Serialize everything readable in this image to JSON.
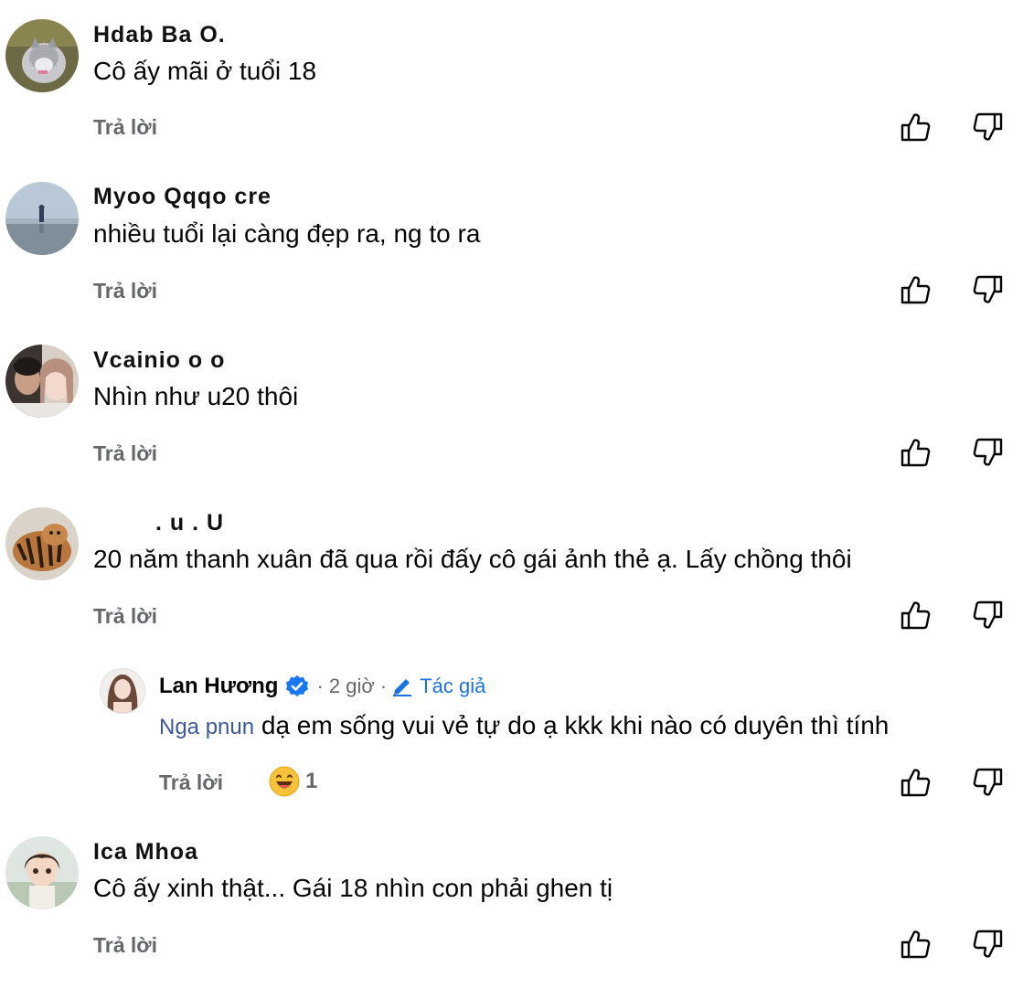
{
  "comments": [
    {
      "name": "Hdab Ba O.",
      "text": "Cô ấy mãi ở tuổi 18",
      "reply_label": "Trả lời"
    },
    {
      "name": "Myoo Qqqo cre",
      "text": "nhiều tuổi lại càng đẹp ra, ng to ra",
      "reply_label": "Trả lời"
    },
    {
      "name": "Vcainio o o",
      "text": "Nhìn như u20 thôi",
      "reply_label": "Trả lời"
    },
    {
      "name": ". u . U",
      "text": "20 năm thanh xuân đã qua rồi đấy cô gái ảnh thẻ ạ. Lấy chồng thôi",
      "reply_label": "Trả lời"
    },
    {
      "name": "Ica Mhoa",
      "text": "Cô ấy xinh thật... Gái 18 nhìn con phải ghen tị",
      "reply_label": "Trả lời"
    }
  ],
  "reply": {
    "name": "Lan Hương",
    "time": "· 2 giờ ·",
    "author_tag": "Tác giả",
    "mention": "Nga pnun",
    "text": "dạ em sống vui vẻ tự do ạ kkk khi nào có duyên thì tính",
    "reply_label": "Trả lời",
    "reaction_count": "1",
    "reaction_icon": "grinning-face-icon"
  },
  "icons": {
    "like": "thumbs-up-icon",
    "dislike": "thumbs-down-icon",
    "verified": "verified-badge-icon",
    "author": "pencil-icon"
  },
  "colors": {
    "secondary_text": "#65676b",
    "verified_blue": "#1877f2",
    "author_blue": "#1b74e4"
  }
}
